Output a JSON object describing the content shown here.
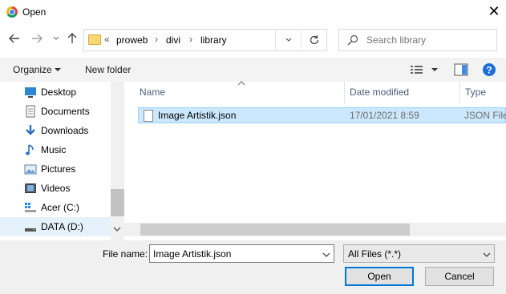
{
  "window": {
    "title": "Open",
    "close_glyph": "✕"
  },
  "nav": {
    "back_icon": "arrow-left-icon",
    "forward_icon": "arrow-right-icon",
    "recent_icon": "chevron-down-icon",
    "up_icon": "arrow-up-icon"
  },
  "address": {
    "overflow": "«",
    "crumbs": [
      "proweb",
      "divi",
      "library"
    ],
    "separator": "›"
  },
  "search": {
    "placeholder": "Search library"
  },
  "command_bar": {
    "organize": "Organize",
    "new_folder": "New folder"
  },
  "sidebar": {
    "items": [
      {
        "label": "Desktop",
        "icon": "desktop-icon"
      },
      {
        "label": "Documents",
        "icon": "documents-icon"
      },
      {
        "label": "Downloads",
        "icon": "downloads-icon"
      },
      {
        "label": "Music",
        "icon": "music-icon"
      },
      {
        "label": "Pictures",
        "icon": "pictures-icon"
      },
      {
        "label": "Videos",
        "icon": "videos-icon"
      },
      {
        "label": "Acer (C:)",
        "icon": "drive-c-icon"
      },
      {
        "label": "DATA (D:)",
        "icon": "drive-d-icon",
        "selected": true
      }
    ]
  },
  "columns": {
    "name": "Name",
    "date": "Date modified",
    "type": "Type"
  },
  "files": [
    {
      "name": "Image Artistik.json",
      "date": "17/01/2021 8:59",
      "type": "JSON File",
      "selected": true
    }
  ],
  "footer": {
    "file_name_label": "File name:",
    "file_name_value": "Image Artistik.json",
    "file_type_value": "All Files (*.*)",
    "open_label": "Open",
    "cancel_label": "Cancel"
  },
  "colors": {
    "accent": "#0078d7",
    "selection": "#cce8ff",
    "help": "#1e6fd9"
  }
}
